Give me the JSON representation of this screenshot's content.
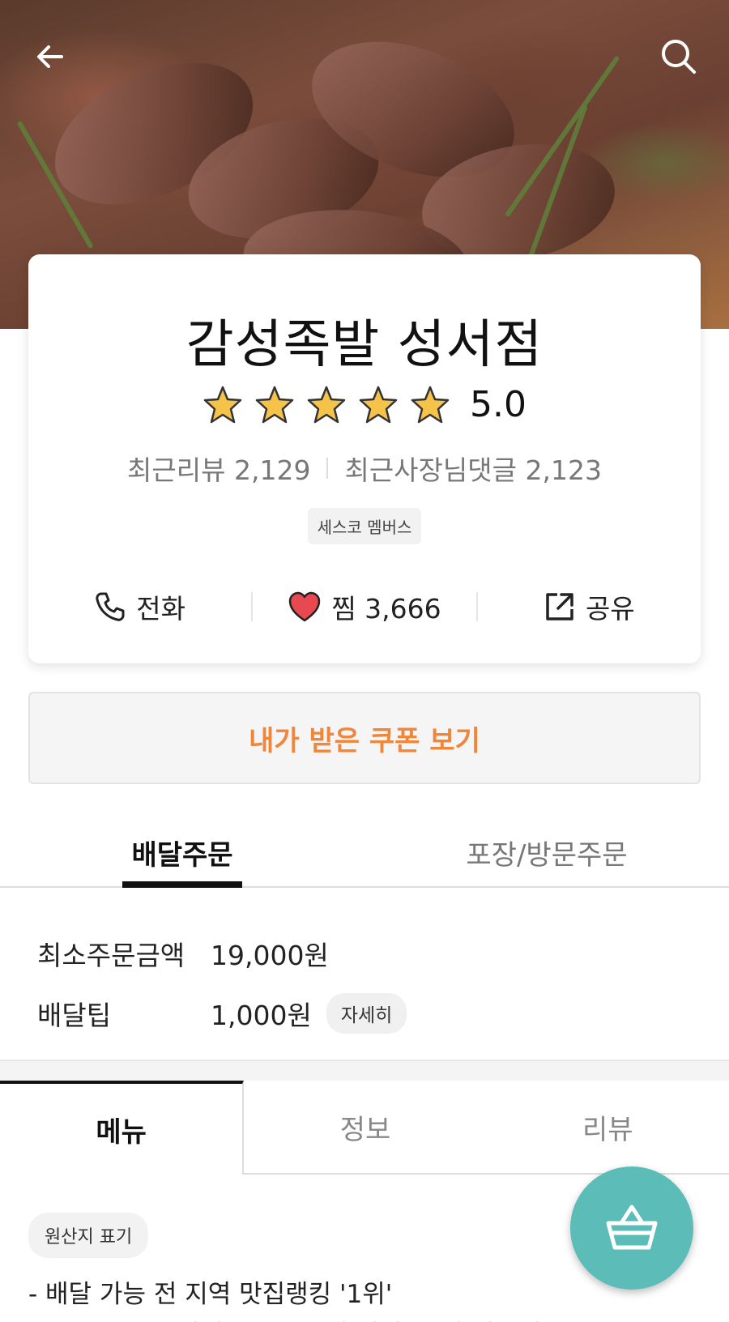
{
  "header": {
    "back_icon": "arrow-left-icon",
    "search_icon": "search-icon"
  },
  "store": {
    "name": "감성족발 성서점",
    "rating": "5.0",
    "stars": 5,
    "recent_reviews": "최근리뷰 2,129",
    "recent_owner_replies": "최근사장님댓글 2,123",
    "badge": "세스코 멤버스"
  },
  "actions": {
    "call": "전화",
    "favorite": "찜 3,666",
    "share": "공유"
  },
  "coupon_button": "내가 받은 쿠폰 보기",
  "order_tabs": [
    {
      "label": "배달주문",
      "active": true
    },
    {
      "label": "포장/방문주문",
      "active": false
    }
  ],
  "delivery_info": {
    "min_order_label": "최소주문금액",
    "min_order_value": "19,000원",
    "tip_label": "배달팁",
    "tip_value": "1,000원",
    "detail_chip": "자세히"
  },
  "content_tabs": [
    {
      "label": "메뉴",
      "active": true
    },
    {
      "label": "정보",
      "active": false
    },
    {
      "label": "리뷰",
      "active": false
    }
  ],
  "origin_chip": "원산지 표기",
  "description": {
    "line1": "-  배달 가능 전 지역 맛집랭킹 '1위'",
    "line2": "-  신입들 한 마디씩 : 그릇이 더 커서 이 밥 가짜식..."
  },
  "colors": {
    "accent_orange": "#f0863a",
    "fab_teal": "#5bbcb8",
    "star_gold": "#f5c24a",
    "heart_red": "#e8484f"
  }
}
